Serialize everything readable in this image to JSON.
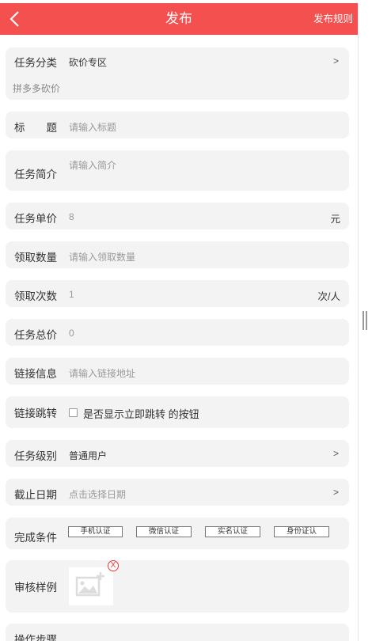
{
  "header": {
    "title": "发布",
    "rules": "发布规则"
  },
  "form": {
    "category": {
      "label": "任务分类",
      "value": "砍价专区",
      "arrow": ">",
      "sub": "拼多多砍价"
    },
    "title": {
      "label": "标　　题",
      "placeholder": "请输入标题"
    },
    "intro": {
      "label": "任务简介",
      "placeholder": "请输入简介"
    },
    "unit_price": {
      "label": "任务单价",
      "value": "8",
      "unit": "元"
    },
    "quantity": {
      "label": "领取数量",
      "placeholder": "请输入领取数量"
    },
    "times": {
      "label": "领取次数",
      "value": "1",
      "unit": "次/人"
    },
    "total": {
      "label": "任务总价",
      "value": "0"
    },
    "link": {
      "label": "链接信息",
      "placeholder": "请输入链接地址"
    },
    "jump": {
      "label": "链接跳转",
      "checkbox_label": "是否显示立即跳转 的按钮"
    },
    "level": {
      "label": "任务级别",
      "value": "普通用户",
      "arrow": ">"
    },
    "deadline": {
      "label": "截止日期",
      "placeholder": "点击选择日期",
      "arrow": ">"
    },
    "conditions": {
      "label": "完成条件",
      "options": [
        "手机认证",
        "微信认证",
        "实名认证",
        "身份证认"
      ]
    },
    "sample": {
      "label": "审核样例",
      "delete": "X"
    },
    "steps": {
      "label": "操作步骤"
    }
  }
}
